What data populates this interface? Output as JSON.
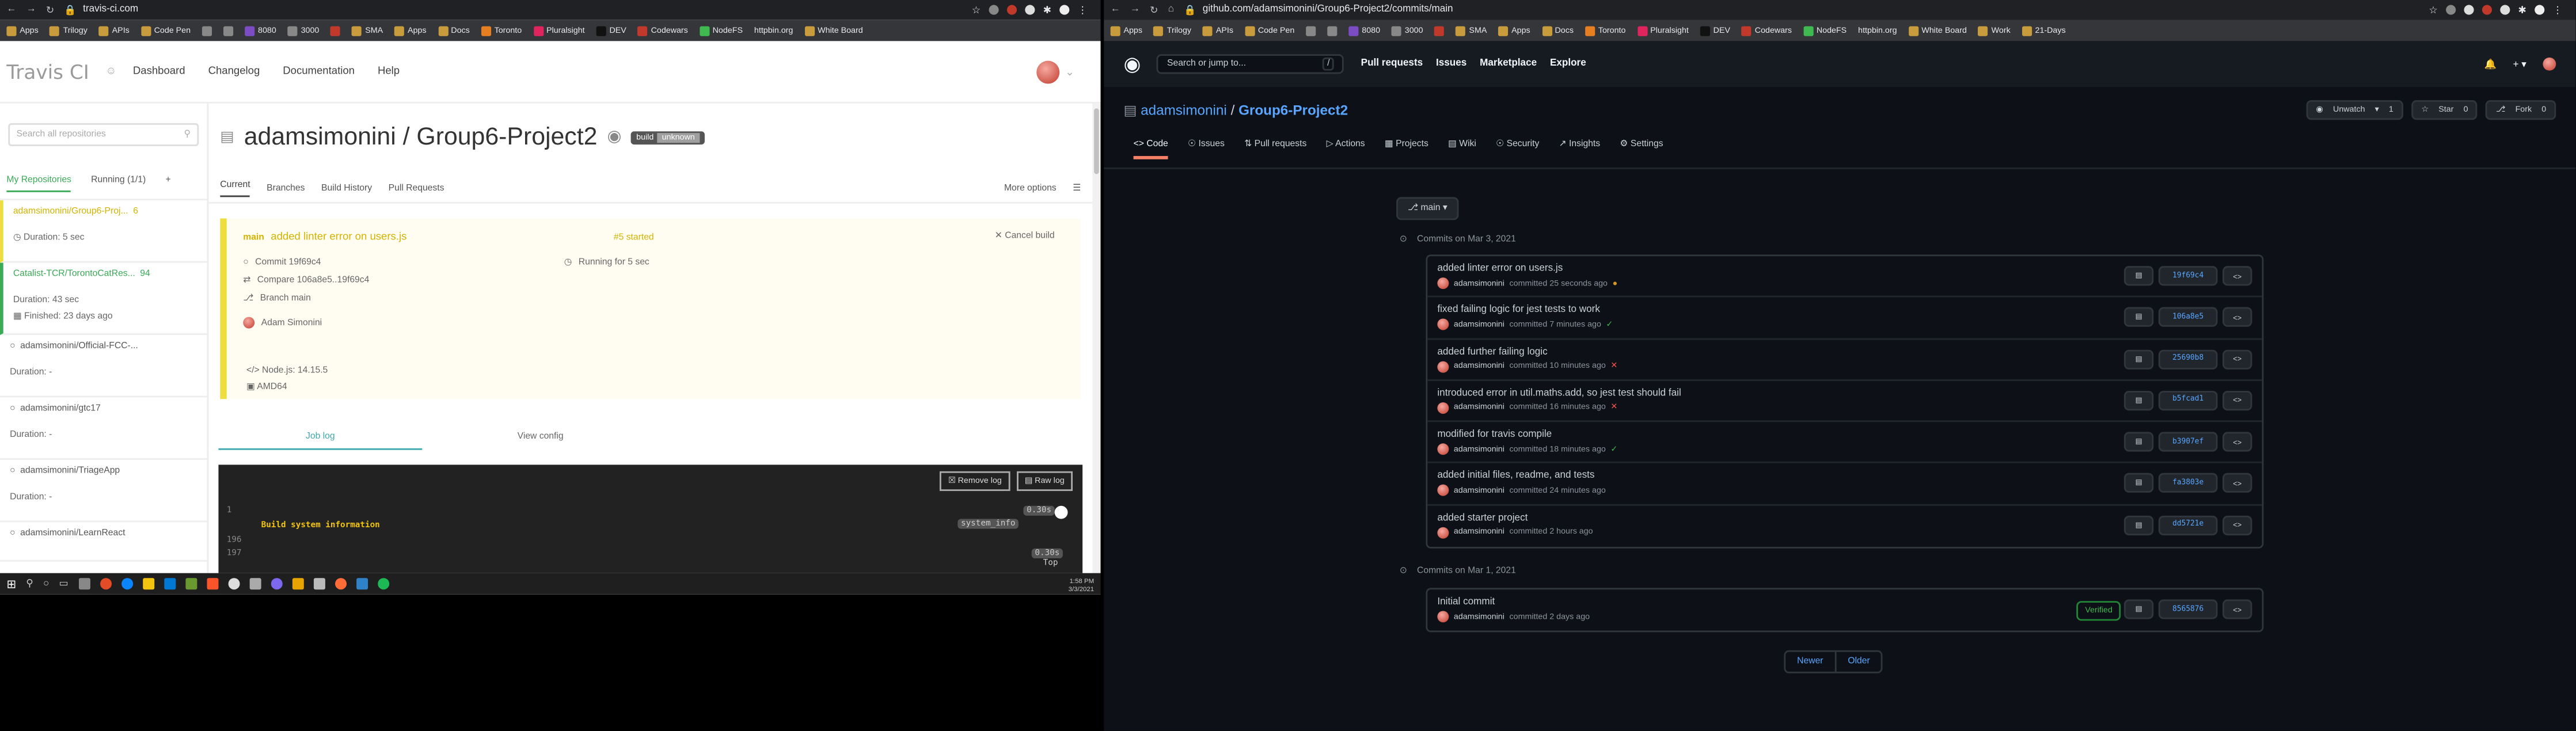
{
  "left": {
    "url": "travis-ci.com",
    "bookmarks": [
      "Apps",
      "Trilogy",
      "APIs",
      "Code Pen",
      "8080",
      "3000",
      "SMA",
      "Apps",
      "Docs",
      "Toronto",
      "Pluralsight",
      "DEV",
      "Codewars",
      "NodeFS",
      "httpbin.org",
      "White Board"
    ],
    "brand": "Travis CI",
    "nav": [
      "Dashboard",
      "Changelog",
      "Documentation",
      "Help"
    ],
    "search_placeholder": "Search all repositories",
    "side_tabs": [
      "My Repositories",
      "Running (1/1)",
      "+"
    ],
    "repos": [
      {
        "name": "adamsimonini/Group6-Proj...",
        "num": "6",
        "l1": "Duration: 5 sec",
        "l2": "",
        "status": "#edde3f"
      },
      {
        "name": "Catalist-TCR/TorontoCatRes...",
        "num": "94",
        "l1": "Duration: 43 sec",
        "l2": "Finished: 23 days ago",
        "status": "#39aa56"
      },
      {
        "name": "adamsimonini/Official-FCC-...",
        "num": "",
        "l1": "Duration: -",
        "l2": "",
        "status": "#fff"
      },
      {
        "name": "adamsimonini/gtc17",
        "num": "",
        "l1": "Duration: -",
        "l2": "",
        "status": "#fff"
      },
      {
        "name": "adamsimonini/TriageApp",
        "num": "",
        "l1": "Duration: -",
        "l2": "",
        "status": "#fff"
      },
      {
        "name": "adamsimonini/LearnReact",
        "num": "",
        "l1": "",
        "l2": "",
        "status": "#fff"
      }
    ],
    "repo_title": "adamsimonini / Group6-Project2",
    "badge": {
      "label": "build",
      "value": "unknown"
    },
    "tabs": [
      "Current",
      "Branches",
      "Build History",
      "Pull Requests"
    ],
    "more_options": "More options",
    "build": {
      "branch": "main",
      "message": "added linter error on users.js",
      "commit": "Commit 19f69c4",
      "compare": "Compare 106a8e5..19f69c4",
      "branch_line": "Branch main",
      "author": "Adam Simonini",
      "number": "#5 started",
      "running": "Running for 5 sec",
      "cancel": "Cancel build",
      "node": "Node.js: 14.15.5",
      "arch": "AMD64"
    },
    "log_tabs": [
      "Job log",
      "View config"
    ],
    "log_buttons": [
      "Remove log",
      "Raw log"
    ],
    "log_lines": [
      "1",
      "Build system information",
      "196",
      "197"
    ],
    "log_tag": "system_info",
    "log_time": "0.30s",
    "log_top": "Top",
    "clock": "1:58 PM",
    "date": "3/3/2021"
  },
  "right": {
    "url": "github.com/adamsimonini/Group6-Project2/commits/main",
    "bookmarks": [
      "Apps",
      "Trilogy",
      "APIs",
      "Code Pen",
      "8080",
      "3000",
      "SMA",
      "Apps",
      "Docs",
      "Toronto",
      "Pluralsight",
      "DEV",
      "Codewars",
      "NodeFS",
      "httpbin.org",
      "White Board",
      "Work",
      "21-Days"
    ],
    "search": "Search or jump to...",
    "search_key": "/",
    "nav": [
      "Pull requests",
      "Issues",
      "Marketplace",
      "Explore"
    ],
    "owner": "adamsimonini",
    "repo": "Group6-Project2",
    "buttons": [
      {
        "label": "Unwatch",
        "count": "1"
      },
      {
        "label": "Star",
        "count": "0"
      },
      {
        "label": "Fork",
        "count": "0"
      }
    ],
    "tabs": [
      "Code",
      "Issues",
      "Pull requests",
      "Actions",
      "Projects",
      "Wiki",
      "Security",
      "Insights",
      "Settings"
    ],
    "branch": "main",
    "groups": [
      {
        "date": "Commits on Mar 3, 2021",
        "commits": [
          {
            "msg": "added linter error on users.js",
            "author": "adamsimonini",
            "when": "committed 25 seconds ago",
            "status": "pend",
            "sha": "19f69c4"
          },
          {
            "msg": "fixed failing logic for jest tests to work",
            "author": "adamsimonini",
            "when": "committed 7 minutes ago",
            "status": "ok",
            "sha": "106a8e5"
          },
          {
            "msg": "added further failing logic",
            "author": "adamsimonini",
            "when": "committed 10 minutes ago",
            "status": "bad",
            "sha": "25690b8"
          },
          {
            "msg": "introduced error in util.maths.add, so jest test should fail",
            "author": "adamsimonini",
            "when": "committed 16 minutes ago",
            "status": "bad",
            "sha": "b5fcad1"
          },
          {
            "msg": "modified for travis compile",
            "author": "adamsimonini",
            "when": "committed 18 minutes ago",
            "status": "ok",
            "sha": "b3907ef"
          },
          {
            "msg": "added initial files, readme, and tests",
            "author": "adamsimonini",
            "when": "committed 24 minutes ago",
            "status": "",
            "sha": "fa3803e"
          },
          {
            "msg": "added starter project",
            "author": "adamsimonini",
            "when": "committed 2 hours ago",
            "status": "",
            "sha": "dd5721e"
          }
        ]
      },
      {
        "date": "Commits on Mar 1, 2021",
        "commits": [
          {
            "msg": "Initial commit",
            "author": "adamsimonini",
            "when": "committed 2 days ago",
            "status": "",
            "sha": "8565876",
            "verified": "Verified"
          }
        ]
      }
    ],
    "pager": [
      "Newer",
      "Older"
    ]
  }
}
